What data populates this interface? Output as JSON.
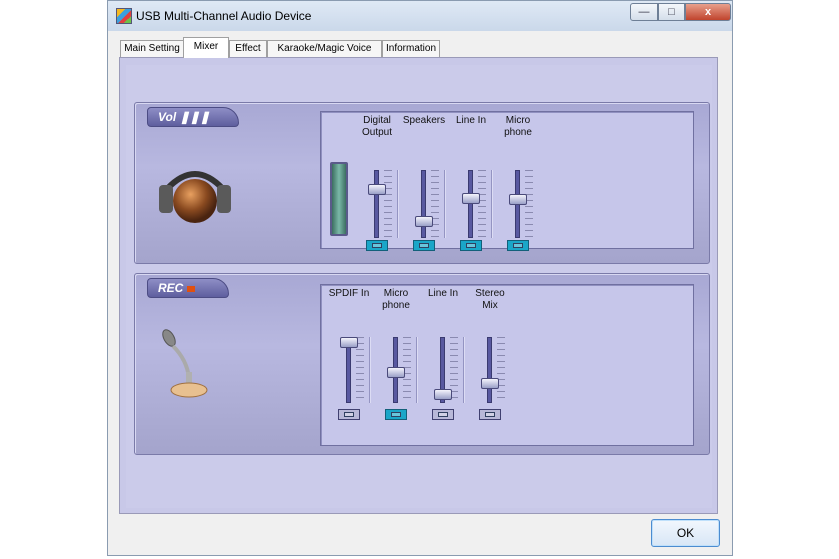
{
  "window": {
    "title": "USB Multi-Channel Audio Device",
    "min_glyph": "—",
    "max_glyph": "□",
    "close_glyph": "x"
  },
  "tabs": [
    {
      "label": "Main Setting",
      "active": false
    },
    {
      "label": "Mixer",
      "active": true
    },
    {
      "label": "Effect",
      "active": false
    },
    {
      "label": "Karaoke/Magic Voice",
      "active": false
    },
    {
      "label": "Information",
      "active": false
    }
  ],
  "playback": {
    "badge": "Vol",
    "icon": "headphones-icon",
    "channels": [
      {
        "label": "Digital\nOutput",
        "level": 0.75,
        "mute_on": true
      },
      {
        "label": "Speakers",
        "level": 0.2,
        "mute_on": true
      },
      {
        "label": "Line In",
        "level": 0.6,
        "mute_on": true
      },
      {
        "label": "Micro\nphone",
        "level": 0.58,
        "mute_on": true
      }
    ]
  },
  "record": {
    "badge": "REC",
    "icon": "microphone-icon",
    "channels": [
      {
        "label": "SPDIF In",
        "level": 1.0,
        "mute_on": false
      },
      {
        "label": "Micro\nphone",
        "level": 0.45,
        "mute_on": true
      },
      {
        "label": "Line In",
        "level": 0.05,
        "mute_on": false
      },
      {
        "label": "Stereo\nMix",
        "level": 0.25,
        "mute_on": false
      }
    ]
  },
  "footer": {
    "ok_label": "OK"
  },
  "colors": {
    "panel": "#c8c8e8",
    "accent": "#1aa6c8",
    "rec_led": "#e05010"
  }
}
